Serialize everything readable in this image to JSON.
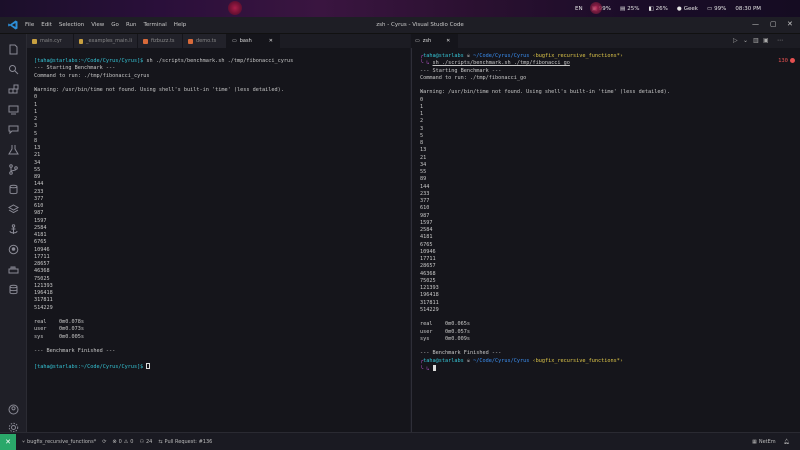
{
  "system_bar": {
    "lang": "EN",
    "cpu": "99%",
    "mem": "25%",
    "disk": "26%",
    "user": "Geek",
    "battery": "99%",
    "time": "08:30 PM"
  },
  "titlebar": {
    "menu": [
      "File",
      "Edit",
      "Selection",
      "View",
      "Go",
      "Run",
      "Terminal",
      "Help"
    ],
    "title": "zsh - Cyrus - Visual Studio Code"
  },
  "tabs_left": [
    {
      "label": "main.cyr",
      "color": "#c8a040"
    },
    {
      "label": "_examples_main.li",
      "color": "#c8a040"
    },
    {
      "label": "fizbuzz.ts",
      "color": "#d86a3a"
    },
    {
      "label": "demo.ts",
      "color": "#d86a3a"
    },
    {
      "label": "bash",
      "color": "#888888"
    }
  ],
  "tab_right": {
    "label": "zsh"
  },
  "left_terminal": {
    "prompt_user": "[taha@starlabs:~/Code/Cyrus/Cyrus]$",
    "command": " sh ./scripts/benchmark.sh ./tmp/fibonacci_cyrus",
    "header1": "--- Starting Benchmark ---",
    "header2": "Command to run: ./tmp/fibonacci_cyrus",
    "warning": "Warning: /usr/bin/time not found. Using shell's built-in 'time' (less detailed).",
    "numbers": [
      "0",
      "1",
      "1",
      "2",
      "3",
      "5",
      "8",
      "13",
      "21",
      "34",
      "55",
      "89",
      "144",
      "233",
      "377",
      "610",
      "987",
      "1597",
      "2584",
      "4181",
      "6765",
      "10946",
      "17711",
      "28657",
      "46368",
      "75025",
      "121393",
      "196418",
      "317811",
      "514229"
    ],
    "real": "real\t0m0.078s",
    "user": "user\t0m0.073s",
    "sys": "sys\t0m0.005s",
    "finished": "--- Benchmark Finished ---",
    "prompt_end": "[taha@starlabs:~/Code/Cyrus/Cyrus]$"
  },
  "right_terminal": {
    "prompt_user": "taha@starlabs",
    "path": "~/Code/Cyrus/Cyrus",
    "branch": "‹bugfix_recursive_functions*›",
    "command": "sh ./scripts/benchmark.sh ./tmp/fibonacci_go",
    "header1": "--- Starting Benchmark ---",
    "header2": "Command to run: ./tmp/fibonacci_go",
    "warning": "Warning: /usr/bin/time not found. Using shell's built-in 'time' (less detailed).",
    "numbers": [
      "0",
      "1",
      "1",
      "2",
      "3",
      "5",
      "8",
      "13",
      "21",
      "34",
      "55",
      "89",
      "144",
      "233",
      "377",
      "610",
      "987",
      "1597",
      "2584",
      "4181",
      "6765",
      "10946",
      "17711",
      "28657",
      "46368",
      "75025",
      "121393",
      "196418",
      "317811",
      "514229"
    ],
    "real": "real\t0m0.065s",
    "user": "user\t0m0.057s",
    "sys": "sys\t0m0.009s",
    "finished": "--- Benchmark Finished ---",
    "exit_code": "130"
  },
  "statusbar": {
    "branch": "bugfix_recursive_functions*",
    "problems_errors": "0",
    "problems_warnings": "0",
    "ports": "24",
    "pull_request": "Pull Request: #136",
    "mode": "NetEm"
  },
  "colors": {
    "accent": "#2aa86a",
    "error": "#e55050",
    "prompt_cyan": "#35c3d4",
    "path_blue": "#3a8ef0",
    "branch_yellow": "#e0c84a"
  }
}
